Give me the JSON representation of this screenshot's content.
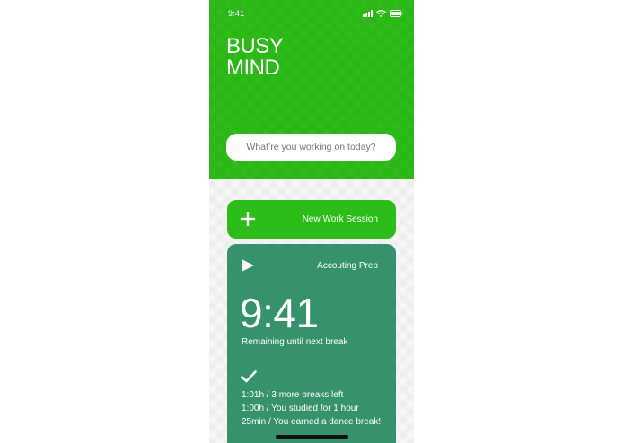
{
  "status_bar": {
    "time": "9:41",
    "icons": [
      "signal-icon",
      "wifi-icon",
      "battery-icon"
    ]
  },
  "header": {
    "app_title": "BUSY\nMIND",
    "prompt_placeholder": "What’re you working on today?"
  },
  "new_session": {
    "icon": "plus-icon",
    "label": "New Work Session"
  },
  "current_session": {
    "icon": "play-icon",
    "task_name": "Accouting Prep",
    "timer": "9:41",
    "timer_caption": "Remaining until next break",
    "completed_icon": "checkmark-icon",
    "history": [
      "1:01h / 3 more breaks left",
      "1:00h / You studied for 1 hour",
      "25min / You earned a dance break!"
    ]
  },
  "colors": {
    "header_green": "#2dbd18",
    "card_teal": "#35926a",
    "prompt_text": "#2f8f61"
  }
}
